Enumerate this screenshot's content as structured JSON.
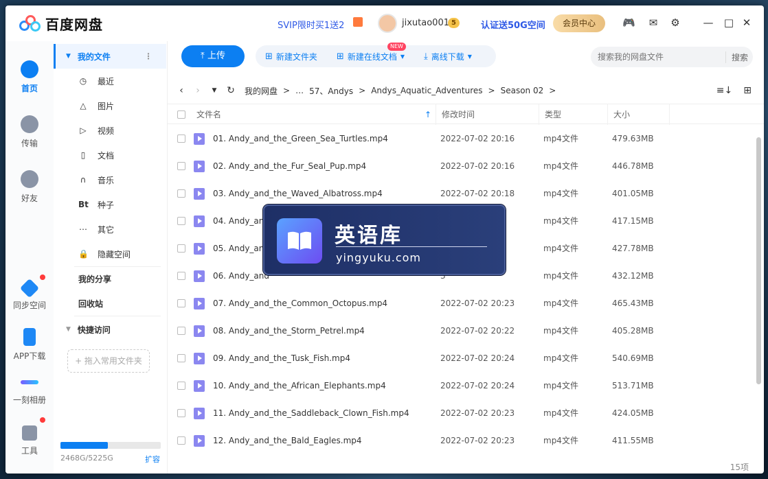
{
  "app": {
    "title": "百度网盘"
  },
  "topbar": {
    "promo": "SVIP限时买1送2",
    "username": "jixutao001",
    "level_badge": "5",
    "verify_promo": "认证送50G空间",
    "vip_center": "会员中心"
  },
  "nav": {
    "items": [
      {
        "label": "首页"
      },
      {
        "label": "传输"
      },
      {
        "label": "好友"
      },
      {
        "label": "同步空间"
      },
      {
        "label": "APP下载"
      },
      {
        "label": "一刻相册"
      },
      {
        "label": "工具"
      }
    ]
  },
  "sidebar": {
    "my_files": "我的文件",
    "items": [
      {
        "label": "最近",
        "icon": "clock-icon"
      },
      {
        "label": "图片",
        "icon": "image-icon"
      },
      {
        "label": "视频",
        "icon": "video-icon"
      },
      {
        "label": "文档",
        "icon": "document-icon"
      },
      {
        "label": "音乐",
        "icon": "headphones-icon"
      },
      {
        "label": "种子",
        "icon": "bt-icon"
      },
      {
        "label": "其它",
        "icon": "more-icon"
      },
      {
        "label": "隐藏空间",
        "icon": "lock-icon"
      }
    ],
    "my_share": "我的分享",
    "recycle": "回收站",
    "quick_access": "快捷访问",
    "drop_hint": "+ 拖入常用文件夹",
    "quota_text": "2468G/5225G",
    "quota_used_fraction": 0.472,
    "expand": "扩容"
  },
  "toolbar": {
    "upload": "上传",
    "new_folder": "新建文件夹",
    "new_doc": "新建在线文档",
    "new_badge": "NEW",
    "offline_download": "离线下载",
    "search_placeholder": "搜索我的网盘文件",
    "search_button": "搜索"
  },
  "breadcrumb": {
    "items": [
      "我的网盘",
      "…",
      "57、Andys",
      "Andys_Aquatic_Adventures",
      "Season 02"
    ]
  },
  "table": {
    "headers": {
      "name": "文件名",
      "time": "修改时间",
      "type": "类型",
      "size": "大小"
    },
    "rows": [
      {
        "name": "01. Andy_and_the_Green_Sea_Turtles.mp4",
        "time": "2022-07-02 20:16",
        "type": "mp4文件",
        "size": "479.63MB"
      },
      {
        "name": "02. Andy_and_the_Fur_Seal_Pup.mp4",
        "time": "2022-07-02 20:16",
        "type": "mp4文件",
        "size": "446.78MB"
      },
      {
        "name": "03. Andy_and_the_Waved_Albatross.mp4",
        "time": "2022-07-02 20:18",
        "type": "mp4文件",
        "size": "401.05MB"
      },
      {
        "name": "04. Andy_and",
        "time": "2",
        "type": "mp4文件",
        "size": "417.15MB"
      },
      {
        "name": "05. Andy_and",
        "time": "2",
        "type": "mp4文件",
        "size": "427.78MB"
      },
      {
        "name": "06. Andy_and",
        "time": "3",
        "type": "mp4文件",
        "size": "432.12MB"
      },
      {
        "name": "07. Andy_and_the_Common_Octopus.mp4",
        "time": "2022-07-02 20:23",
        "type": "mp4文件",
        "size": "465.43MB"
      },
      {
        "name": "08. Andy_and_the_Storm_Petrel.mp4",
        "time": "2022-07-02 20:22",
        "type": "mp4文件",
        "size": "405.28MB"
      },
      {
        "name": "09. Andy_and_the_Tusk_Fish.mp4",
        "time": "2022-07-02 20:24",
        "type": "mp4文件",
        "size": "540.69MB"
      },
      {
        "name": "10. Andy_and_the_African_Elephants.mp4",
        "time": "2022-07-02 20:24",
        "type": "mp4文件",
        "size": "513.71MB"
      },
      {
        "name": "11. Andy_and_the_Saddleback_Clown_Fish.mp4",
        "time": "2022-07-02 20:23",
        "type": "mp4文件",
        "size": "424.05MB"
      },
      {
        "name": "12. Andy_and_the_Bald_Eagles.mp4",
        "time": "2022-07-02 20:23",
        "type": "mp4文件",
        "size": "411.55MB"
      }
    ],
    "count": "15项"
  },
  "watermark": {
    "title": "英语库",
    "url": "yingyuku.com"
  },
  "colors": {
    "accent": "#0c7ff2",
    "promo_blue": "#2e59e6",
    "file_icon": "#8b87f0"
  }
}
